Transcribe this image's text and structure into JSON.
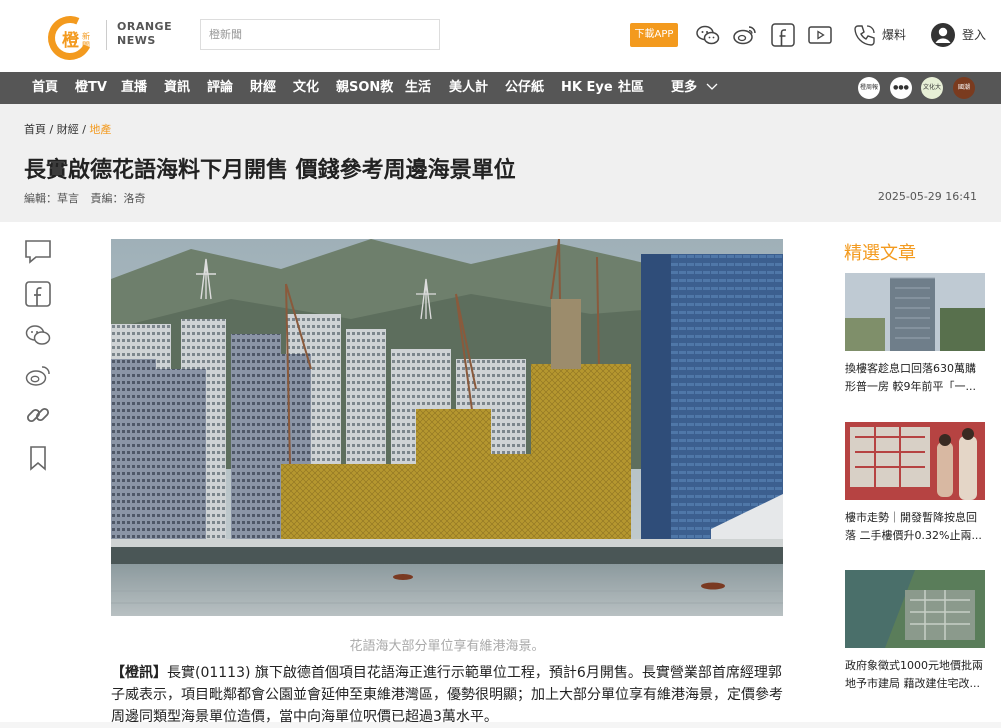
{
  "header": {
    "logo_char": "橙",
    "logo_small": "新聞",
    "logo_en_line1": "ORANGE",
    "logo_en_line2": "NEWS",
    "search_placeholder": "橙新聞",
    "download_label": "下載APP",
    "report_label": "爆料",
    "login_label": "登入",
    "accent_color": "#f39a1e"
  },
  "nav": {
    "items": [
      "首頁",
      "橙TV",
      "直播",
      "資訊",
      "評論",
      "財經",
      "文化",
      "親SON教",
      "生活",
      "美人計",
      "公仔紙",
      "HK Eye",
      "社區"
    ],
    "more_label": "更多",
    "badges": [
      "橙周報",
      "●●●",
      "文化大灣區",
      "國潮"
    ]
  },
  "article": {
    "breadcrumb": [
      "首頁",
      "財經",
      "地產"
    ],
    "title": "長實啟德花語海料下月開售 價錢參考周邊海景單位",
    "editor": "編輯：草言",
    "chief_editor": "責編：洛奇",
    "datetime": "2025-05-29 16:41",
    "caption": "花語海大部分單位享有維港海景。",
    "lead_tag": "【橙訊】",
    "lead_text": "長實(01113) 旗下啟德首個項目花語海正進行示範單位工程，預計6月開售。長實營業部首席經理郭子威表示，項目毗鄰都會公園並會延伸至東維港灣區，優勢很明顯；加上大部分單位享有維港海景，定價參考周邊同類型海景單位造價，當中向海單位呎價已超過3萬水平。"
  },
  "sidebar": {
    "title": "精選文章",
    "items": [
      {
        "text": "換樓客趁息口回落630萬購形普一房 較9年前平「一..."
      },
      {
        "text": "樓市走勢｜開發暫降按息回落 二手樓價升0.32%止兩..."
      },
      {
        "text": "政府象徵式1000元地價批兩地予市建局 藉改建住宅改..."
      }
    ]
  }
}
